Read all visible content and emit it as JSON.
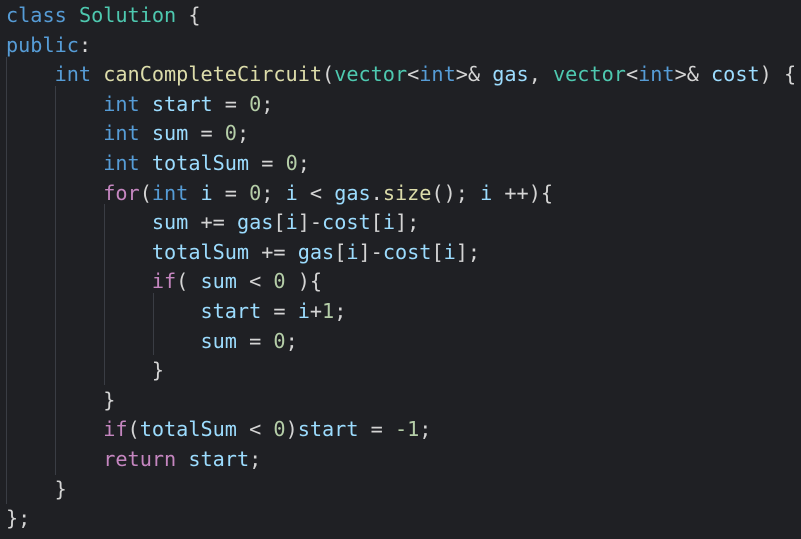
{
  "editor": {
    "language": "cpp",
    "theme_colors": {
      "background": "#1f2024",
      "keyword": "#569cd6",
      "control": "#c586c0",
      "function": "#dcdcaa",
      "type": "#4ec9b0",
      "number": "#b5cea8",
      "variable": "#9cdcfe",
      "text": "#d4d4d4"
    },
    "lines": [
      "class Solution {",
      "public:",
      "    int canCompleteCircuit(vector<int>& gas, vector<int>& cost) {",
      "        int start = 0;",
      "        int sum = 0;",
      "        int totalSum = 0;",
      "        for(int i = 0; i < gas.size(); i ++){",
      "            sum += gas[i]-cost[i];",
      "            totalSum += gas[i]-cost[i];",
      "            if( sum < 0 ){",
      "                start = i+1;",
      "                sum = 0;",
      "            }",
      "        }",
      "        if(totalSum < 0)start = -1;",
      "        return start;",
      "    }",
      "};"
    ]
  }
}
